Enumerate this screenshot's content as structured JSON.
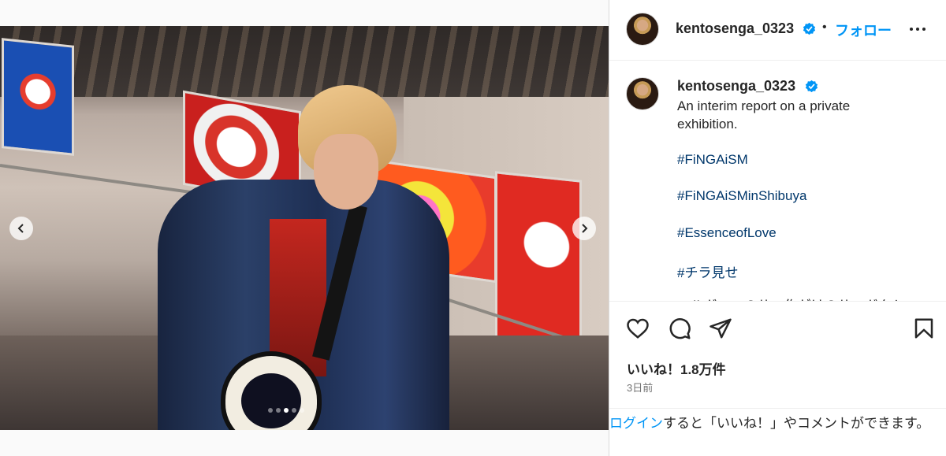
{
  "post": {
    "username": "kentosenga_0323",
    "follow_label": "フォロー",
    "separator": "•",
    "caption": "An interim report on a private\nexhibition.",
    "hashtags": [
      "#FiNGAiSM",
      "#FiNGAiSMinShibuya",
      "#EssenceofLove",
      "#チラ見せ"
    ],
    "truncated_line": "…ルガ…ーのサ…作がけのサ…ガクト",
    "likes": "いいね！1.8万件",
    "date": "3日前",
    "login_link": "ログイン",
    "login_text": "すると「いいね！」やコメントができます。"
  },
  "media": {
    "slide_count": 5,
    "active_slide": 3
  },
  "colors": {
    "accent": "#0095f6",
    "hashtag": "#00376b",
    "text": "#262626",
    "muted": "#737373"
  },
  "icons": [
    "chevron-left-icon",
    "chevron-right-icon",
    "verified-badge-icon",
    "more-icon",
    "heart-icon",
    "comment-icon",
    "share-icon",
    "bookmark-icon"
  ]
}
